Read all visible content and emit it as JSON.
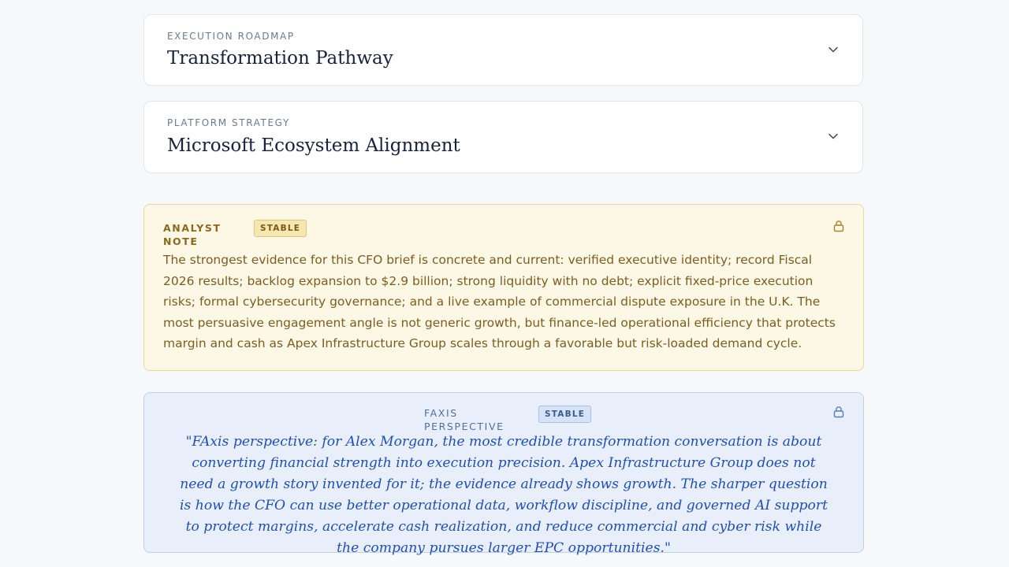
{
  "sections": [
    {
      "eyebrow": "EXECUTION ROADMAP",
      "title": "Transformation Pathway",
      "icon": "chevron-down-icon"
    },
    {
      "eyebrow": "PLATFORM STRATEGY",
      "title": "Microsoft Ecosystem Alignment",
      "icon": "chevron-down-icon"
    }
  ],
  "analyst_note": {
    "label": "ANALYST NOTE",
    "badge": "STABLE",
    "icon": "lock-icon",
    "body": "The strongest evidence for this CFO brief is concrete and current: verified executive identity; record Fiscal 2026 results; backlog expansion to $2.9 billion; strong liquidity with no debt; explicit fixed-price execution risks; formal cybersecurity governance; and a live example of commercial dispute exposure in the U.K. The most persuasive engagement angle is not generic growth, but finance-led operational efficiency that protects margin and cash as Apex Infrastructure Group scales through a favorable but risk-loaded demand cycle."
  },
  "faxis_perspective": {
    "label": "FAXIS PERSPECTIVE",
    "badge": "STABLE",
    "icon": "lock-icon",
    "body": "\"FAxis perspective: for Alex Morgan, the most credible transformation conversation is about converting financial strength into execution precision. Apex Infrastructure Group does not need a growth story invented for it; the evidence already shows growth. The sharper question is how the CFO can use better operational data, workflow discipline, and governed AI support to protect margins, accelerate cash realization, and reduce commercial and cyber risk while the company pursues larger EPC opportunities.\""
  },
  "colors": {
    "analyst_bg": "#fdf8e6",
    "analyst_text": "#7b5e1f",
    "faxis_bg": "#e8effb",
    "faxis_text": "#1f4fb5"
  }
}
